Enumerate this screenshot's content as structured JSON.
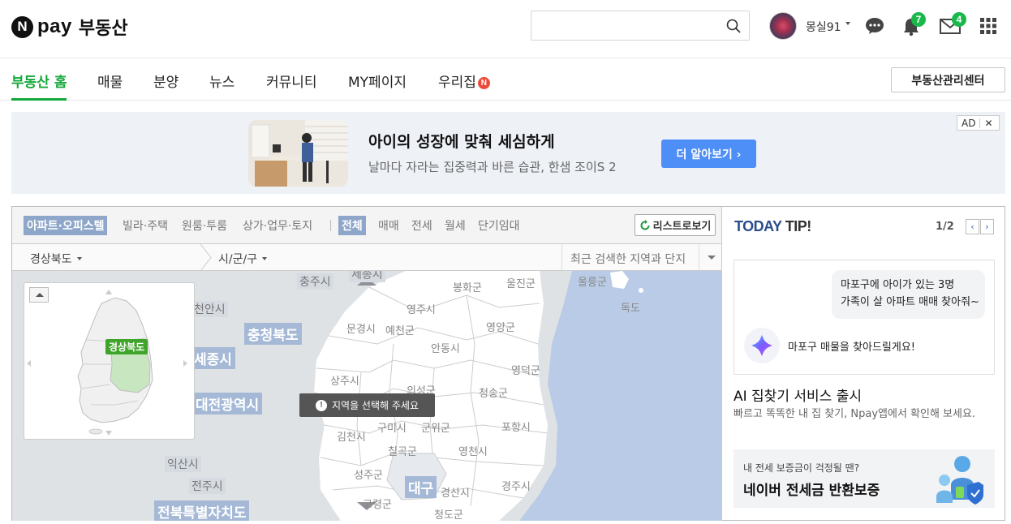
{
  "header": {
    "logo_n": "N",
    "logo_pay": "pay",
    "logo_title": "부동산",
    "search_placeholder": "",
    "user_name": "몽실91",
    "alarm_count": "7",
    "mail_count": "4",
    "brand_color": "#14a83b"
  },
  "nav": {
    "items": [
      {
        "label": "부동산 홈"
      },
      {
        "label": "매물"
      },
      {
        "label": "분양"
      },
      {
        "label": "뉴스"
      },
      {
        "label": "커뮤니티"
      },
      {
        "label": "MY페이지"
      },
      {
        "label": "우리집"
      }
    ],
    "new_badge": "N",
    "center_button": "부동산관리센터"
  },
  "ad": {
    "title": "아이의 성장에 맞춰 세심하게",
    "description": "날마다 자라는 집중력과 바른 습관, 한샘 조이S 2",
    "cta": "더 알아보기 ›",
    "tag": "AD",
    "close": "✕"
  },
  "filters": {
    "property_types": [
      "아파트·오피스텔",
      "빌라·주택",
      "원룸·투룸",
      "상가·업무·토지"
    ],
    "deal_types": [
      "전체",
      "매매",
      "전세",
      "월세",
      "단기임대"
    ],
    "list_button": "리스트로보기"
  },
  "location": {
    "province": "경상북도",
    "city": "시/군/구",
    "recent": "최근 검색한 지역과 단지"
  },
  "map": {
    "toast": "지역을 선택해 주세요",
    "toast_icon": "!",
    "minimap_label": "경상북도",
    "labels": {
      "chungju": "충주시",
      "sejong_top": "세종시",
      "bonghwa": "봉화군",
      "uljin": "울진군",
      "ulleung": "울릉군",
      "dokdo": "독도",
      "cheonan": "천안시",
      "chungbuk": "충청북도",
      "yeongju": "영주시",
      "mungyeong": "문경시",
      "yecheon": "예천군",
      "yeongyang": "영양군",
      "sejong": "세종시",
      "andong": "안동시",
      "yeongdeok": "영덕군",
      "sangju": "상주시",
      "uiseong": "의성군",
      "cheongsong": "청송군",
      "daejeon": "대전광역시",
      "gumi": "구미시",
      "gunwi": "군위군",
      "pohang": "포항시",
      "gimcheon": "김천시",
      "chilgok": "칠곡군",
      "yeongcheon": "영천시",
      "iksan": "익산시",
      "seongju": "성주군",
      "daegu": "대구",
      "gyeongsan": "경산시",
      "gyeongju": "경주시",
      "jeonju": "전주시",
      "goryeong": "고령군",
      "cheongdo": "청도군",
      "jeonbuk": "전북특별자치도"
    }
  },
  "tip": {
    "title_a": "TODAY",
    "title_b": " TIP!",
    "page": "1/2",
    "prev": "‹",
    "next": "›",
    "chat_line1": "마포구에 아이가 있는 3명",
    "chat_line2": "가족이 살 아파트 매매 찾아줘~",
    "ai_reply": "마포구 매물을 찾아드릴게요!",
    "headline": "AI 집찾기 서비스 출시",
    "body": "빠르고 똑똑한 내 집 찾기, Npay앱에서 확인해 보세요.",
    "banner_small": "내 전세 보증금이 걱정될 땐?",
    "banner_big": "네이버 전세금 반환보증"
  }
}
